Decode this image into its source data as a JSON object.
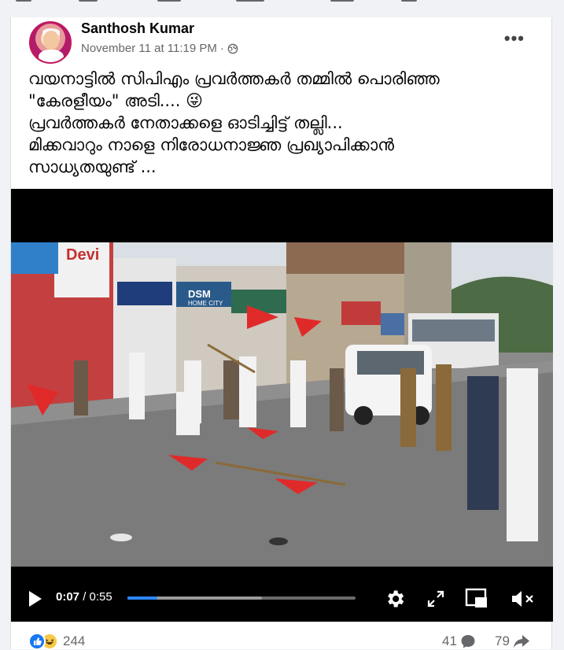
{
  "post": {
    "author": "Santhosh Kumar",
    "timestamp": "November 11 at 11:19 PM",
    "audience_separator": "·",
    "more_label": "•••",
    "text_lines": [
      "വയനാട്ടിൽ സിപിഎം പ്രവർത്തകർ തമ്മിൽ പൊരിഞ്ഞ",
      "\"കേരളീയം\" അടി.... 😜",
      "പ്രവർത്തകർ നേതാക്കളെ ഓടിച്ചിട്ട് തല്ലി...",
      "മിക്കവാറും നാളെ നിരോധനാജ്ഞ പ്രഖ്യാപിക്കാൻ",
      "സാധ്യതയുണ്ട് ..."
    ]
  },
  "video_frame": {
    "signs": [
      "Devi",
      "DSM",
      "HOME CITY"
    ]
  },
  "video": {
    "current_time": "0:07",
    "separator": " / ",
    "duration": "0:55",
    "progress_fraction": 0.13,
    "buffered_fraction": 0.59,
    "icons": [
      "play-icon",
      "settings-gear-icon",
      "fullscreen-icon",
      "miniplayer-icon",
      "mute-icon"
    ]
  },
  "engagement": {
    "reactions_count": "244",
    "comments_count": "41",
    "shares_count": "79",
    "reaction_icons": [
      "like-icon",
      "haha-icon"
    ]
  },
  "colors": {
    "accent": "#2d88ff",
    "like": "#1877f2",
    "haha": "#f7c948",
    "muted_text": "#65676b"
  }
}
